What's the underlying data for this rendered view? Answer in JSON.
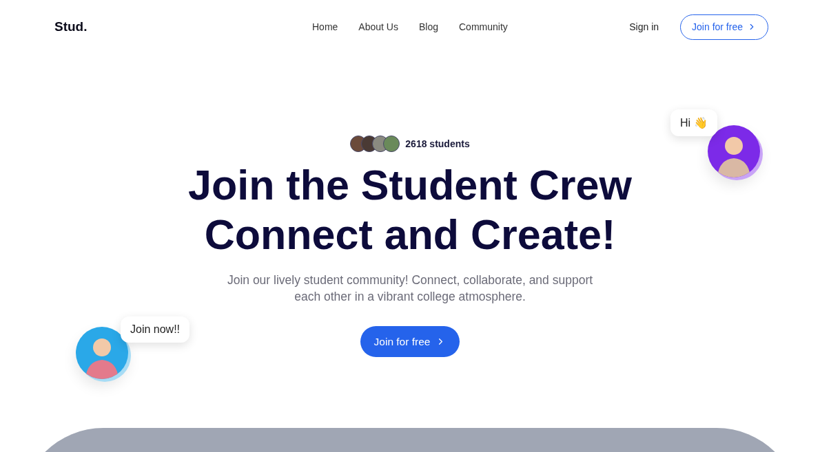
{
  "nav": {
    "logo": "Stud.",
    "links": [
      "Home",
      "About Us",
      "Blog",
      "Community"
    ],
    "sign_in": "Sign in",
    "join": "Join for free"
  },
  "hero": {
    "students": "2618 students",
    "title_lines": [
      "Join the Student Crew",
      "Connect and Create!"
    ],
    "subtitle": "Join our lively student community! Connect, collaborate, and support each other in a vibrant college atmosphere.",
    "cta": "Join for free"
  },
  "bubbles": [
    {
      "text": "Hi 👋",
      "kind": "right"
    },
    {
      "text": "Join now!!",
      "kind": "left"
    }
  ]
}
